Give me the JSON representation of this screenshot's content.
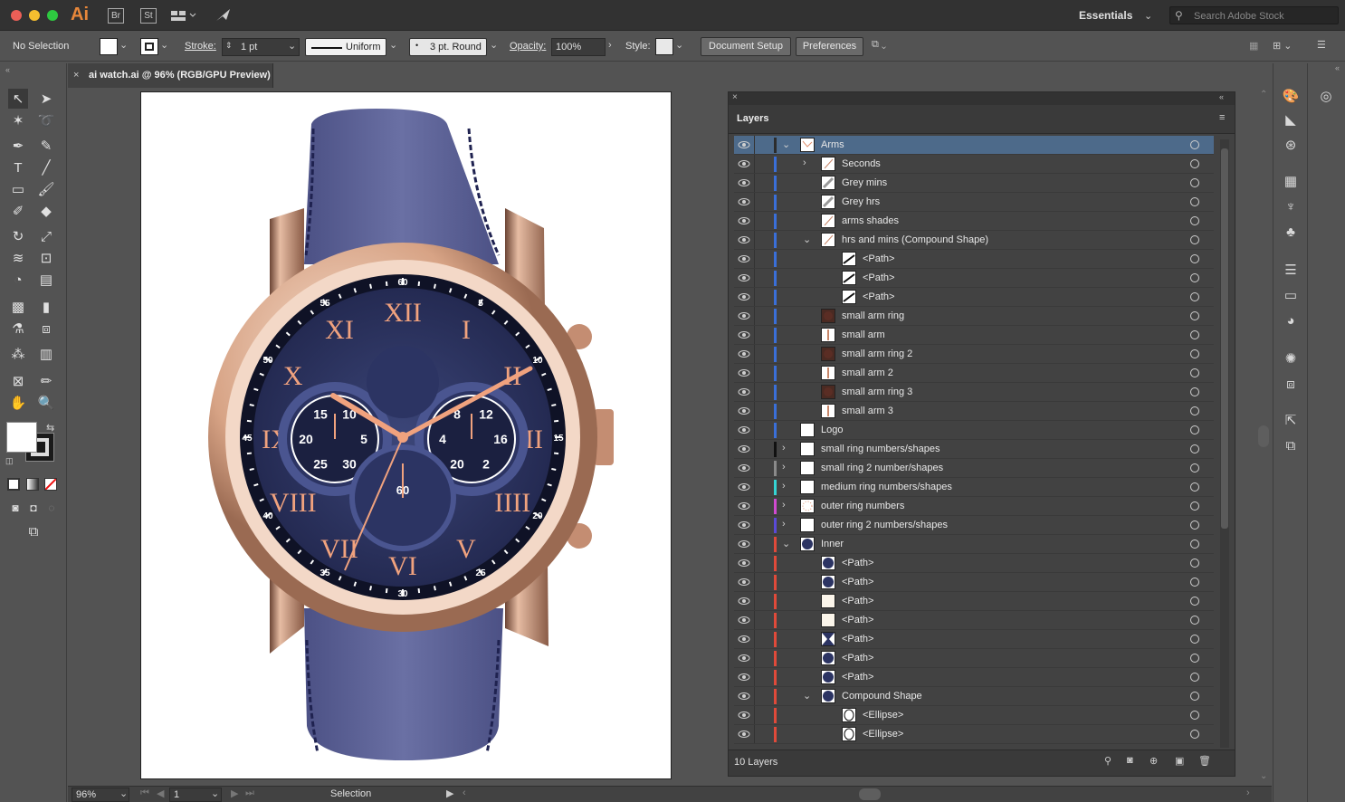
{
  "app": {
    "logo": "Ai",
    "bridge": "Br",
    "stock": "St",
    "workspace": "Essentials",
    "search_placeholder": "Search Adobe Stock"
  },
  "control": {
    "selection": "No Selection",
    "stroke_label": "Stroke:",
    "stroke_value": "1 pt",
    "profile": "Uniform",
    "brush": "3 pt. Round",
    "opacity_label": "Opacity:",
    "opacity_value": "100%",
    "style_label": "Style:",
    "doc_setup": "Document Setup",
    "preferences": "Preferences"
  },
  "document": {
    "tab_title": "ai watch.ai @ 96% (RGB/GPU Preview)"
  },
  "layers_panel": {
    "title": "Layers",
    "footer_count": "10 Layers",
    "rows": [
      {
        "name": "Arms",
        "indent": 0,
        "chev": "down",
        "color": "#2c2c2c",
        "thumb": "arms",
        "selected": true
      },
      {
        "name": "Seconds",
        "indent": 1,
        "chev": "right",
        "color": "#3a6fd8",
        "thumb": "line"
      },
      {
        "name": "Grey mins",
        "indent": 1,
        "chev": "",
        "color": "#3a6fd8",
        "thumb": "grey"
      },
      {
        "name": "Grey hrs",
        "indent": 1,
        "chev": "",
        "color": "#3a6fd8",
        "thumb": "grey"
      },
      {
        "name": "arms shades",
        "indent": 1,
        "chev": "",
        "color": "#3a6fd8",
        "thumb": "line"
      },
      {
        "name": "hrs and mins (Compound Shape)",
        "indent": 1,
        "chev": "down",
        "color": "#3a6fd8",
        "thumb": "line"
      },
      {
        "name": "<Path>",
        "indent": 2,
        "chev": "",
        "color": "#3a6fd8",
        "thumb": "path"
      },
      {
        "name": "<Path>",
        "indent": 2,
        "chev": "",
        "color": "#3a6fd8",
        "thumb": "path"
      },
      {
        "name": "<Path>",
        "indent": 2,
        "chev": "",
        "color": "#3a6fd8",
        "thumb": "path"
      },
      {
        "name": "small arm ring",
        "indent": 1,
        "chev": "",
        "color": "#3a6fd8",
        "thumb": "ring"
      },
      {
        "name": "small arm",
        "indent": 1,
        "chev": "",
        "color": "#3a6fd8",
        "thumb": "stick"
      },
      {
        "name": "small arm ring 2",
        "indent": 1,
        "chev": "",
        "color": "#3a6fd8",
        "thumb": "ring"
      },
      {
        "name": "small arm 2",
        "indent": 1,
        "chev": "",
        "color": "#3a6fd8",
        "thumb": "stick"
      },
      {
        "name": "small arm ring 3",
        "indent": 1,
        "chev": "",
        "color": "#3a6fd8",
        "thumb": "ring"
      },
      {
        "name": "small arm 3",
        "indent": 1,
        "chev": "",
        "color": "#3a6fd8",
        "thumb": "stick"
      },
      {
        "name": "Logo",
        "indent": 0,
        "chev": "",
        "color": "#3a6fd8",
        "thumb": "blank"
      },
      {
        "name": "small ring numbers/shapes",
        "indent": 0,
        "chev": "right",
        "color": "#111111",
        "thumb": "blank"
      },
      {
        "name": "small ring 2 number/shapes",
        "indent": 0,
        "chev": "right",
        "color": "#8a8a8a",
        "thumb": "blank"
      },
      {
        "name": "medium ring numbers/shapes",
        "indent": 0,
        "chev": "right",
        "color": "#35d4d4",
        "thumb": "blank"
      },
      {
        "name": "outer ring numbers",
        "indent": 0,
        "chev": "right",
        "color": "#d04ad0",
        "thumb": "dots"
      },
      {
        "name": "outer ring 2 numbers/shapes",
        "indent": 0,
        "chev": "right",
        "color": "#5a4ad8",
        "thumb": "blank"
      },
      {
        "name": "Inner",
        "indent": 0,
        "chev": "down",
        "color": "#e04a3a",
        "thumb": "navy"
      },
      {
        "name": "<Path>",
        "indent": 1,
        "chev": "",
        "color": "#e04a3a",
        "thumb": "navy"
      },
      {
        "name": "<Path>",
        "indent": 1,
        "chev": "",
        "color": "#e04a3a",
        "thumb": "navy"
      },
      {
        "name": "<Path>",
        "indent": 1,
        "chev": "",
        "color": "#e04a3a",
        "thumb": "cream"
      },
      {
        "name": "<Path>",
        "indent": 1,
        "chev": "",
        "color": "#e04a3a",
        "thumb": "cream"
      },
      {
        "name": "<Path>",
        "indent": 1,
        "chev": "",
        "color": "#e04a3a",
        "thumb": "navyx"
      },
      {
        "name": "<Path>",
        "indent": 1,
        "chev": "",
        "color": "#e04a3a",
        "thumb": "navy"
      },
      {
        "name": "<Path>",
        "indent": 1,
        "chev": "",
        "color": "#e04a3a",
        "thumb": "navy"
      },
      {
        "name": "Compound Shape",
        "indent": 1,
        "chev": "down",
        "color": "#e04a3a",
        "thumb": "navy"
      },
      {
        "name": "<Ellipse>",
        "indent": 2,
        "chev": "",
        "color": "#e04a3a",
        "thumb": "ellipse"
      },
      {
        "name": "<Ellipse>",
        "indent": 2,
        "chev": "",
        "color": "#e04a3a",
        "thumb": "ellipse"
      }
    ]
  },
  "status": {
    "zoom": "96%",
    "artboard": "1",
    "tool": "Selection"
  },
  "watch": {
    "outer_numbers": [
      "60",
      "5",
      "10",
      "15",
      "20",
      "25",
      "30",
      "35",
      "40",
      "45",
      "50",
      "55"
    ],
    "roman": [
      "XII",
      "I",
      "II",
      "III",
      "IIII",
      "V",
      "VI",
      "VII",
      "VIII",
      "IX",
      "X",
      "XI"
    ],
    "left_sub": [
      "25",
      "20",
      "15",
      "10",
      "5",
      "30"
    ],
    "right_sub": [
      "20",
      "4",
      "8",
      "12",
      "16",
      "2"
    ],
    "bottom_sub": [
      "60"
    ]
  },
  "colors": {
    "accent": "#4d6a8a",
    "strap": "#5c6294",
    "case": "#d9a98a",
    "dial": "#2c3463",
    "numerals": "#f0a27e"
  }
}
